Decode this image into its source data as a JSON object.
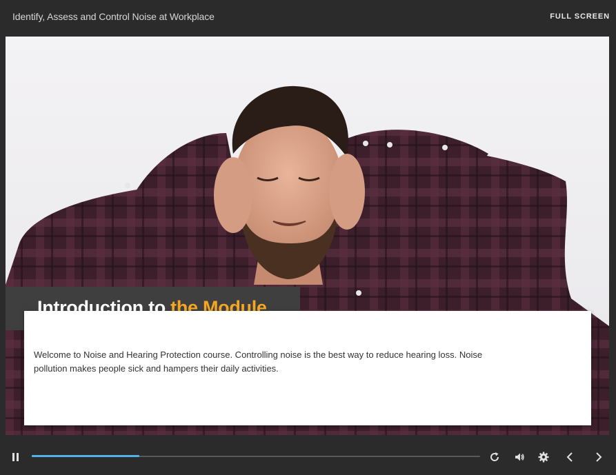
{
  "header": {
    "course_title": "Identify, Assess and Control Noise at Workplace",
    "fullscreen_label": "FULL SCREEN"
  },
  "slide": {
    "title_part1": "Introduction to ",
    "title_part2": "the Module",
    "title_highlight_color": "#f5a623",
    "body_text": "Welcome to Noise and Hearing Protection course. Controlling noise is the best way to reduce hearing loss. Noise pollution makes people sick and hampers their daily activities."
  },
  "player": {
    "progress_fraction": 0.24,
    "accent_color": "#4fb3e8",
    "icons": [
      "pause-icon",
      "replay-icon",
      "volume-icon",
      "settings-icon",
      "chevron-left-icon",
      "chevron-right-icon"
    ]
  }
}
